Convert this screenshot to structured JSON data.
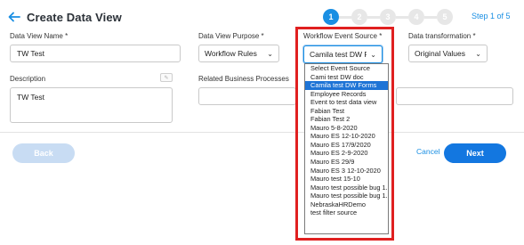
{
  "header": {
    "title": "Create Data View"
  },
  "wizard": {
    "steps": [
      "1",
      "2",
      "3",
      "4",
      "5"
    ],
    "active_step": 1,
    "step_label": "Step 1 of 5"
  },
  "form": {
    "data_view_name": {
      "label": "Data View Name *",
      "value": "TW Test"
    },
    "data_view_purpose": {
      "label": "Data View Purpose *",
      "value": "Workflow Rules"
    },
    "workflow_event_source": {
      "label": "Workflow Event Source *",
      "value": "Camila test DW Forms"
    },
    "data_transformation": {
      "label": "Data transformation *",
      "value": "Original Values"
    },
    "description": {
      "label": "Description",
      "value": "TW Test"
    },
    "related_business_processes": {
      "label": "Related Business Processes",
      "value": ""
    }
  },
  "dropdown": {
    "options": [
      "Select Event Source",
      "Cami test DW doc",
      "Camila test DW Forms",
      "Employee Records",
      "Event to test data view",
      "Fabian Test",
      "Fabian Test 2",
      "Mauro 5-8-2020",
      "Mauro ES 12-10-2020",
      "Mauro ES 17/9/2020",
      "Mauro ES 2-9-2020",
      "Mauro ES 29/9",
      "Mauro ES 3 12-10-2020",
      "Mauro test 15-10",
      "Mauro test possible bug 1.1",
      "Mauro test possible bug 1.2",
      "NebraskaHRDemo",
      "test filter source"
    ],
    "selected_index": 2
  },
  "footer": {
    "back_label": "Back",
    "cancel_label": "Cancel",
    "next_label": "Next"
  },
  "icons": {
    "back": "arrow-left-icon",
    "dropdown": "chevron-down-icon",
    "edit": "edit-icon"
  },
  "colors": {
    "accent": "#1a8fe3",
    "primary_button": "#1377e0",
    "disabled_button": "#c8dcf3",
    "highlight": "#e02020",
    "selected_option": "#1e74d6"
  }
}
